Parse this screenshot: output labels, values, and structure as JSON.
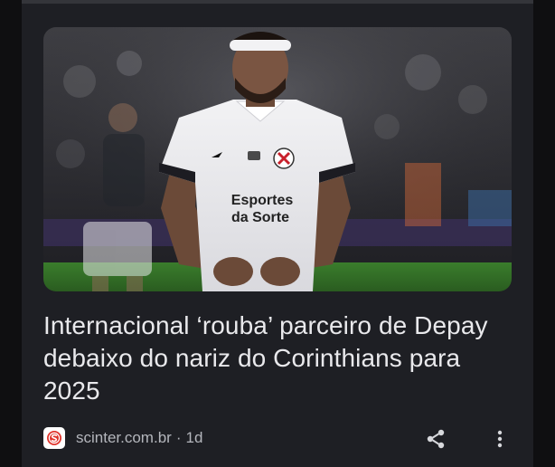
{
  "article": {
    "headline": "Internacional ‘rouba’ parceiro de Depay debaixo do nariz do Corinthians para 2025",
    "image": {
      "sponsor_line1": "Esportes",
      "sponsor_line2": "da Sorte"
    }
  },
  "source": {
    "name": "scinter.com.br",
    "separator": "·",
    "age": "1d",
    "favicon_icon": "scinter-logo-icon"
  },
  "actions": {
    "share_icon": "share-icon",
    "more_icon": "more-vertical-icon"
  },
  "colors": {
    "background": "#0f0f11",
    "card": "#1e1f24",
    "headline": "#e9e9ec",
    "meta": "#b4b6bc",
    "favicon_red": "#e0342c"
  }
}
